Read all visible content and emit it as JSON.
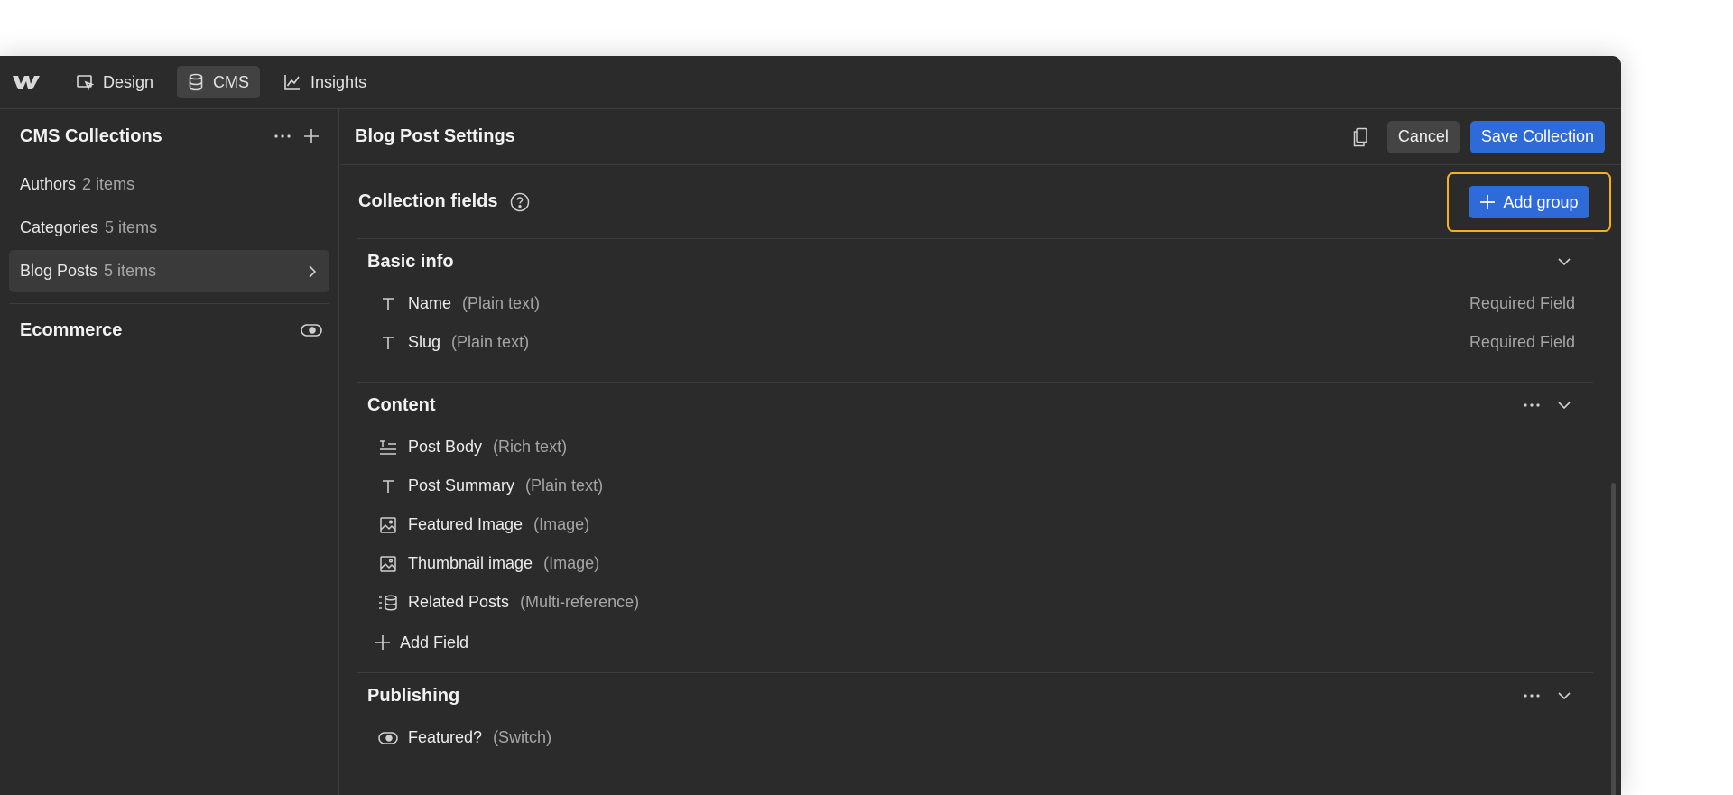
{
  "nav": {
    "tabs": [
      {
        "label": "Design",
        "icon": "cursor-box-icon"
      },
      {
        "label": "CMS",
        "icon": "database-icon"
      },
      {
        "label": "Insights",
        "icon": "chart-line-icon"
      }
    ]
  },
  "sidebar": {
    "title": "CMS Collections",
    "items": [
      {
        "label": "Authors",
        "count": "2 items"
      },
      {
        "label": "Categories",
        "count": "5 items"
      },
      {
        "label": "Blog Posts",
        "count": "5 items"
      }
    ],
    "ecommerce_label": "Ecommerce"
  },
  "main": {
    "title": "Blog Post Settings",
    "cancel_label": "Cancel",
    "save_label": "Save Collection",
    "collection_fields_label": "Collection fields",
    "add_group_label": "Add group",
    "groups": [
      {
        "title": "Basic info",
        "fields": [
          {
            "name": "Name",
            "type": "(Plain text)",
            "required": "Required Field",
            "icon": "text-t-icon"
          },
          {
            "name": "Slug",
            "type": "(Plain text)",
            "required": "Required Field",
            "icon": "text-t-icon"
          }
        ]
      },
      {
        "title": "Content",
        "fields": [
          {
            "name": "Post Body",
            "type": "(Rich text)",
            "icon": "rich-text-icon"
          },
          {
            "name": "Post Summary",
            "type": "(Plain text)",
            "icon": "text-t-icon"
          },
          {
            "name": "Featured Image",
            "type": "(Image)",
            "icon": "image-icon"
          },
          {
            "name": "Thumbnail image",
            "type": "(Image)",
            "icon": "image-icon"
          },
          {
            "name": "Related Posts",
            "type": "(Multi-reference)",
            "icon": "multi-reference-icon"
          }
        ],
        "add_field_label": "Add Field"
      },
      {
        "title": "Publishing",
        "fields": [
          {
            "name": "Featured?",
            "type": "(Switch)",
            "icon": "switch-icon"
          }
        ]
      }
    ]
  },
  "colors": {
    "background": "#2b2b2b",
    "accent": "#2f6ad9",
    "highlight": "#f5b01a",
    "muted_text": "#a6a6a6"
  }
}
